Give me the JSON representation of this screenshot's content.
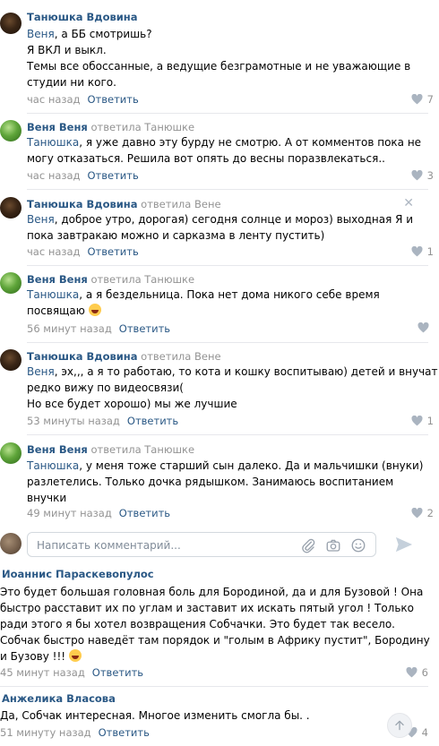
{
  "replies": [
    {
      "author": "Танюшка Вдовина",
      "replied_to": "",
      "addressee": "Веня",
      "lines": [
        ", а ББ смотришь?",
        "Я ВКЛ и выкл.",
        "Темы все обоссанные, а ведущие безграмотные и не уважающие в",
        "студии ни кого."
      ],
      "time": "час назад",
      "reply_label": "Ответить",
      "likes": "7"
    },
    {
      "author": "Веня Веня",
      "replied_to": "ответила Танюшке",
      "addressee": "Танюшка",
      "lines": [
        ", я уже давно эту бурду не смотрю. А от комментов пока не",
        "могу отказаться. Решила вот опять до весны поразвлекаться.."
      ],
      "time": "час назад",
      "reply_label": "Ответить",
      "likes": "3"
    },
    {
      "author": "Танюшка Вдовина",
      "replied_to": "ответила Вене",
      "addressee": "Веня",
      "lines": [
        ", доброе утро, дорогая) сегодня солнце и мороз) выходная Я и",
        "пока завтракаю можно и сарказма в ленту пустить)"
      ],
      "time": "час назад",
      "reply_label": "Ответить",
      "likes": "1",
      "close_glyph": "✕"
    },
    {
      "author": "Веня Веня",
      "replied_to": "ответила Танюшке",
      "addressee": "Танюшка",
      "lines": [
        ", а я бездельница. Пока нет дома никого себе время",
        "посвящаю"
      ],
      "time": "56 минут назад",
      "reply_label": "Ответить",
      "likes": ""
    },
    {
      "author": "Танюшка Вдовина",
      "replied_to": "ответила Вене",
      "addressee": "Веня",
      "lines": [
        ", эх,,, а я то работаю, то кота и кошку воспитываю) детей и внучат",
        "редко вижу по видеосвязи(",
        "Но все будет хорошо) мы же лучшие"
      ],
      "time": "53 минуты назад",
      "reply_label": "Ответить",
      "likes": "1"
    },
    {
      "author": "Веня Веня",
      "replied_to": "ответила Танюшке",
      "addressee": "Танюшка",
      "lines": [
        ", у меня тоже старший сын далеко. Да и мальчишки (внуки)",
        "разлетелись. Только дочка рядышком. Занимаюсь воспитанием",
        "внучки"
      ],
      "time": "49 минут назад",
      "reply_label": "Ответить",
      "likes": "2"
    }
  ],
  "composer": {
    "placeholder": "Написать комментарий..."
  },
  "comments": [
    {
      "author": "Иоаннис Параскевопулос",
      "lines": [
        "Это будет большая головная боль для Бородиной, да и для Бузовой ! Она",
        "быстро расставит их по углам и заставит их искать пятый угол ! Только",
        "ради этого я бы хотел возвращения Собчачки. Это будет так весело.",
        "Собчак быстро наведёт там порядок и \"голым в Африку пустит\", Бородину",
        "и Бузову !!!"
      ],
      "time": "45 минут назад",
      "reply_label": "Ответить",
      "likes": "6"
    },
    {
      "author": "Анжелика Власова",
      "lines": [
        "Да, Собчак интересная. Многое изменить смогла бы. ."
      ],
      "time": "51 минуту назад",
      "reply_label": "Ответить",
      "likes": "4"
    }
  ],
  "icons": {
    "like": "heart-icon",
    "attach": "paperclip-icon",
    "camera": "camera-icon",
    "emoji": "smile-icon",
    "send": "send-icon",
    "scroll": "arrow-up-icon",
    "laughing_emoji": "laughing-emoji-icon",
    "grin_emoji": "grinning-emoji-icon"
  }
}
